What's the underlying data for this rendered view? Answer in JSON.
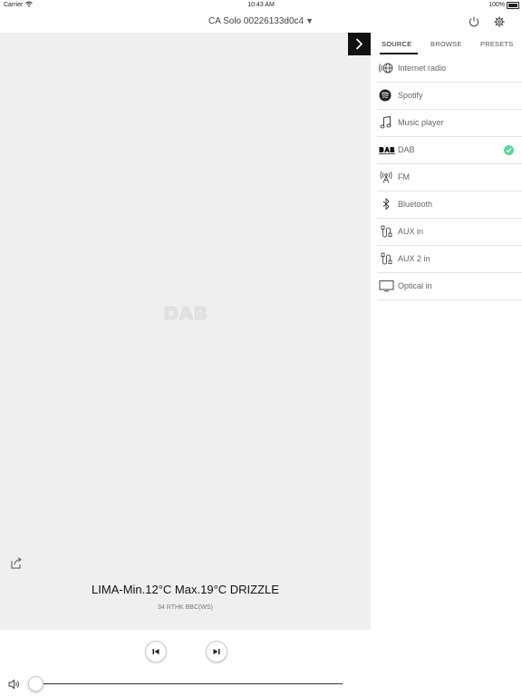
{
  "status_bar": {
    "carrier": "Carrier",
    "time": "10:43 AM",
    "battery": "100%"
  },
  "header": {
    "device_name": "CA Solo 00226133d0c4",
    "caret": "▼"
  },
  "now_playing": {
    "title": "LIMA-Min.12°C Max.19°C DRIZZLE",
    "subtitle": "34 RTHK BBC(WS)",
    "volume_fraction": 0.0
  },
  "tabs": [
    {
      "label": "SOURCE",
      "active": true
    },
    {
      "label": "BROWSE",
      "active": false
    },
    {
      "label": "PRESETS",
      "active": false
    }
  ],
  "sources": [
    {
      "label": "Internet radio",
      "icon": "internet-radio-icon",
      "selected": false
    },
    {
      "label": "Spotify",
      "icon": "spotify-icon",
      "selected": false
    },
    {
      "label": "Music player",
      "icon": "music-note-icon",
      "selected": false
    },
    {
      "label": "DAB",
      "icon": "dab-icon",
      "selected": true
    },
    {
      "label": "FM",
      "icon": "fm-antenna-icon",
      "selected": false
    },
    {
      "label": "Bluetooth",
      "icon": "bluetooth-icon",
      "selected": false
    },
    {
      "label": "AUX in",
      "icon": "aux-cable-icon",
      "selected": false
    },
    {
      "label": "AUX 2 in",
      "icon": "aux-cable-icon",
      "selected": false
    },
    {
      "label": "Optical in",
      "icon": "optical-tv-icon",
      "selected": false
    }
  ],
  "colors": {
    "selected_check": "#5fd39a",
    "main_background": "#efefef"
  }
}
